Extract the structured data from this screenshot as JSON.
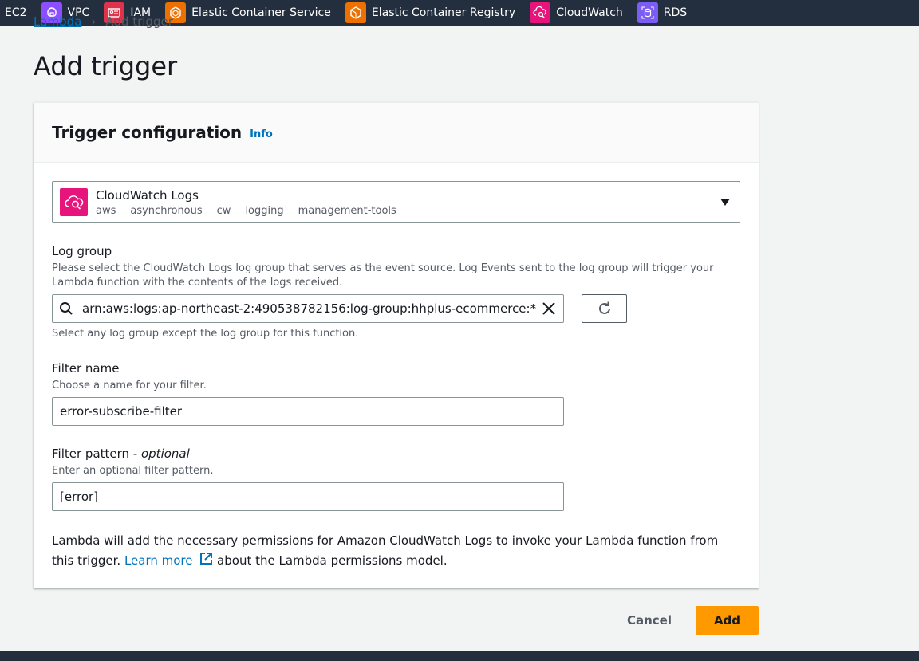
{
  "favorites": [
    {
      "label": "EC2",
      "icon": "none",
      "color": ""
    },
    {
      "label": "VPC",
      "icon": "vpc-icon",
      "color": "#8c4fff"
    },
    {
      "label": "IAM",
      "icon": "iam-icon",
      "color": "#dd344c"
    },
    {
      "label": "Elastic Container Service",
      "icon": "ecs-icon",
      "color": "#ed7100"
    },
    {
      "label": "Elastic Container Registry",
      "icon": "ecr-icon",
      "color": "#ed7100"
    },
    {
      "label": "CloudWatch",
      "icon": "cloudwatch-icon",
      "color": "#e7157b"
    },
    {
      "label": "RDS",
      "icon": "rds-icon",
      "color": "#7b5df5"
    }
  ],
  "breadcrumb": {
    "root": "Lambda",
    "current": "Add trigger"
  },
  "page_title": "Add trigger",
  "card": {
    "title": "Trigger configuration",
    "info": "Info",
    "source": {
      "name": "CloudWatch Logs",
      "tags": [
        "aws",
        "asynchronous",
        "cw",
        "logging",
        "management-tools"
      ]
    },
    "log_group": {
      "label": "Log group",
      "description": "Please select the CloudWatch Logs log group that serves as the event source. Log Events sent to the log group will trigger your Lambda function with the contents of the logs received.",
      "value": "arn:aws:logs:ap-northeast-2:490538782156:log-group:hhplus-ecommerce:*",
      "hint": "Select any log group except the log group for this function."
    },
    "filter_name": {
      "label": "Filter name",
      "description": "Choose a name for your filter.",
      "value": "error-subscribe-filter"
    },
    "filter_pattern": {
      "label": "Filter pattern - ",
      "optional": "optional",
      "description": "Enter an optional filter pattern.",
      "value": "[error]"
    },
    "permissions": {
      "before": "Lambda will add the necessary permissions for Amazon CloudWatch Logs to invoke your Lambda function from this trigger. ",
      "link": "Learn more",
      "after": " about the Lambda permissions model."
    }
  },
  "actions": {
    "cancel": "Cancel",
    "add": "Add"
  },
  "colors": {
    "accent": "#ff9900",
    "link": "#0073bb",
    "nav": "#232f3e"
  }
}
